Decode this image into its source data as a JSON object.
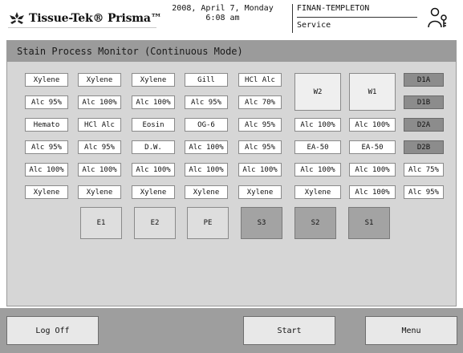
{
  "header": {
    "brand": "Tissue-Tek® Prisma™",
    "date": "2008, April 7, Monday",
    "time": "6:08 am",
    "user": "FINAN-TEMPLETON",
    "role": "Service",
    "user_icon": "person-key-icon"
  },
  "panel": {
    "title": "Stain Process Monitor (Continuous Mode)"
  },
  "grid": {
    "columns": [
      [
        "Xylene",
        "Alc 95%",
        "Hemato",
        "Alc 95%",
        "Alc 100%",
        "Xylene"
      ],
      [
        "Xylene",
        "Alc 100%",
        "HCl Alc",
        "Alc 95%",
        "Alc 100%",
        "Xylene"
      ],
      [
        "Xylene",
        "Alc 100%",
        "Eosin",
        "D.W.",
        "Alc 100%",
        "Xylene"
      ],
      [
        "Gill",
        "Alc 95%",
        "OG-6",
        "Alc 100%",
        "Alc 100%",
        "Xylene"
      ],
      [
        "HCl Alc",
        "Alc 70%",
        "Alc 95%",
        "Alc 95%",
        "Alc 100%",
        "Xylene"
      ],
      [
        "W2",
        "Alc 100%",
        "EA-50",
        "Alc 100%",
        "Xylene"
      ],
      [
        "W1",
        "Alc 100%",
        "EA-50",
        "Alc 100%",
        "Alc 100%"
      ],
      [
        "D1A",
        "D1B",
        "D2A",
        "D2B",
        "Alc 75%",
        "Alc 95%"
      ]
    ],
    "bottom": [
      "E1",
      "E2",
      "PE",
      "S3",
      "S2",
      "S1"
    ]
  },
  "footer": {
    "logoff": "Log Off",
    "start": "Start",
    "menu": "Menu"
  }
}
